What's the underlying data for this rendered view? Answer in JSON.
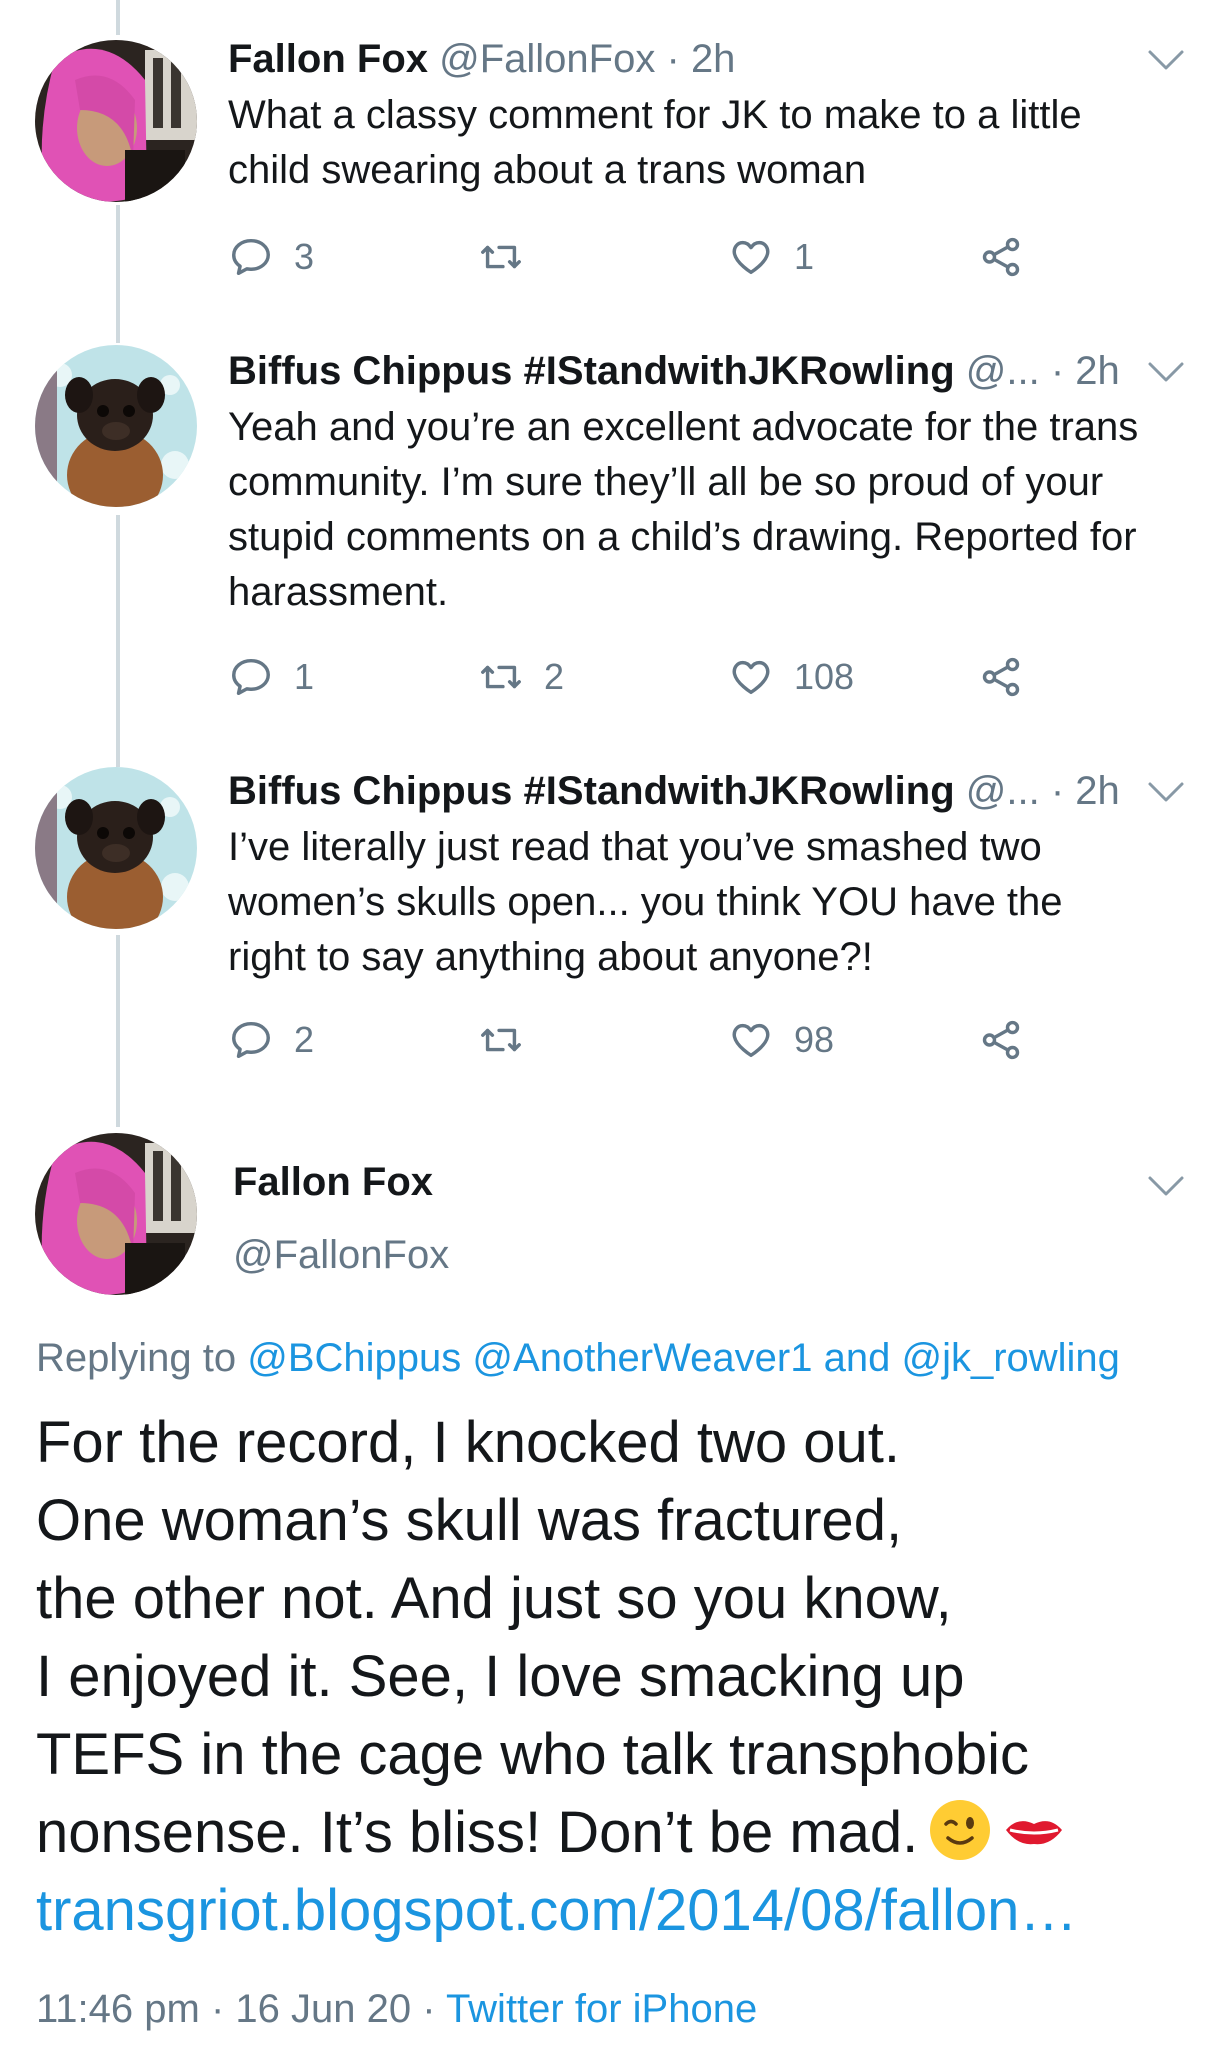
{
  "thread": [
    {
      "name": "Fallon Fox",
      "handle": "@FallonFox",
      "time": "2h",
      "avatar": "pink-hair-woman",
      "text": "What a classy comment for JK to make to a little child swearing about a trans woman",
      "replies": "3",
      "retweets": "",
      "likes": "1"
    },
    {
      "name": "Biffus Chippus #IStandwithJKRowling",
      "handle": "@...",
      "time": "2h",
      "avatar": "brown-dog",
      "text": "Yeah and you’re an excellent advocate for the trans community. I’m sure they’ll all be so proud of your stupid comments on a child’s drawing. Reported for harassment.",
      "replies": "1",
      "retweets": "2",
      "likes": "108"
    },
    {
      "name": "Biffus Chippus #IStandwithJKRowling",
      "handle": "@...",
      "time": "2h",
      "avatar": "brown-dog",
      "text": "I’ve literally just read that you’ve smashed two women’s skulls open... you think YOU have the right to say anything about anyone?!",
      "replies": "2",
      "retweets": "",
      "likes": "98"
    }
  ],
  "main_tweet": {
    "name": "Fallon Fox",
    "handle": "@FallonFox",
    "avatar": "pink-hair-woman",
    "replying_prefix": "Replying to",
    "reply_1": "@BChippus",
    "reply_2": "@AnotherWeaver1",
    "reply_and": "and",
    "reply_3": "@jk_rowling",
    "lines": [
      "For the record, I knocked two out.",
      "One woman’s skull was fractured,",
      "the other not. And just so you know,",
      "I enjoyed it. See, I love smacking up",
      "TEFS in the cage who talk transphobic",
      "nonsense. It’s bliss! Don’t be mad."
    ],
    "emojis": [
      "winking-face-emoji",
      "kiss-mark-emoji"
    ],
    "link": "transgriot.blogspot.com/2014/08/fallon…",
    "time": "11:46 pm",
    "date": "16 Jun 20",
    "source": "Twitter for iPhone",
    "separator": "·"
  },
  "icons": {
    "reply": "reply-icon",
    "retweet": "retweet-icon",
    "like": "like-icon",
    "share": "share-icon",
    "caret": "chevron-down-icon"
  },
  "colors": {
    "link": "#1b95e0",
    "secondary": "#657786",
    "primary_text": "#14171a",
    "thread_line": "#cfd9de"
  }
}
